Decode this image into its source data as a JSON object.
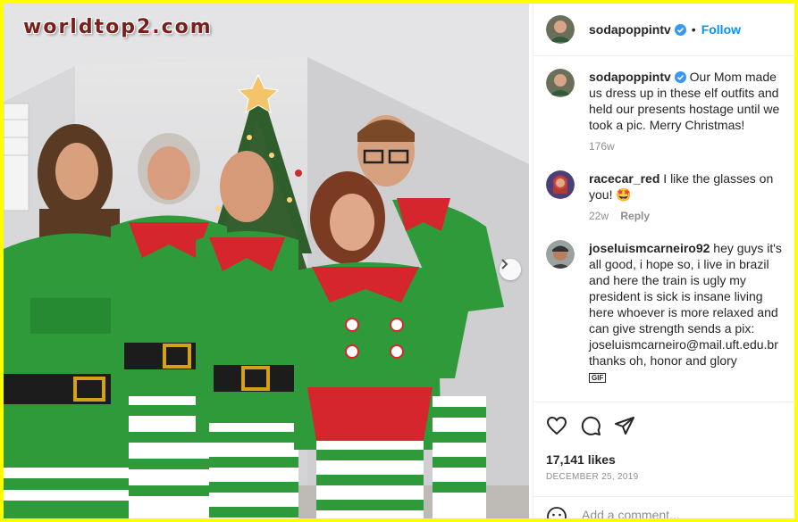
{
  "watermark": "worldtop2.com",
  "post": {
    "username": "sodapoppintv",
    "follow_label": "Follow",
    "separator": "•",
    "caption_username": "sodapoppintv",
    "caption_text": "Our Mom made us dress up in these elf outfits and held our presents hostage until we took a pic. Merry Christmas!",
    "caption_age": "176w",
    "likes": "17,141 likes",
    "date": "DECEMBER 25, 2019",
    "add_comment_placeholder": "Add a comment..."
  },
  "comments": [
    {
      "username": "racecar_red",
      "text": "I like the glasses on you! 🤩",
      "age": "22w",
      "reply_label": "Reply"
    },
    {
      "username": "joseluismcarneiro92",
      "text": "hey guys it's all good, i hope so, i live in brazil and here the train is ugly my president is sick is insane living here whoever is more relaxed and can give strength sends a pix: joseluismcarneiro@mail.uft.edu.br thanks oh, honor and glory",
      "gif_badge": "GIF"
    }
  ],
  "icons": {
    "next": "chevron-right-icon",
    "like": "heart-icon",
    "comment": "comment-icon",
    "share": "share-icon",
    "emoji": "emoji-icon",
    "verified": "verified-badge-icon"
  },
  "colors": {
    "watermark_border": "#ffff00",
    "link_blue": "#0095f6",
    "verified_blue": "#3897f0",
    "elf_green": "#2e9a3a",
    "elf_red": "#d5262e"
  }
}
